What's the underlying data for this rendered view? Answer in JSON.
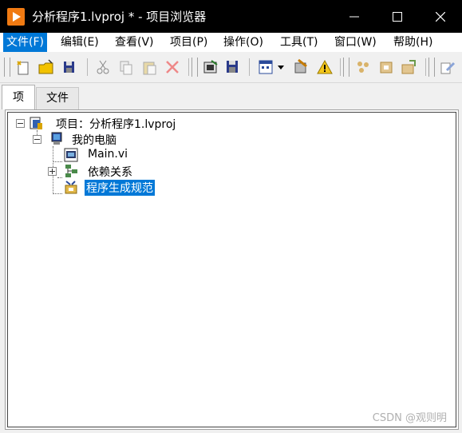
{
  "window": {
    "title": "分析程序1.lvproj * - 项目浏览器",
    "controls": [
      "minimize",
      "maximize",
      "close"
    ]
  },
  "menubar": {
    "items": [
      {
        "label": "文件(F)",
        "active": true
      },
      {
        "label": "编辑(E)"
      },
      {
        "label": "查看(V)"
      },
      {
        "label": "项目(P)"
      },
      {
        "label": "操作(O)"
      },
      {
        "label": "工具(T)"
      },
      {
        "label": "窗口(W)"
      },
      {
        "label": "帮助(H)"
      }
    ]
  },
  "toolbar": {
    "buttons": [
      "new-icon",
      "open-icon",
      "save-all-icon",
      "cut-icon",
      "copy-icon",
      "paste-icon",
      "delete-icon",
      "build-icon",
      "save-icon",
      "view-icon",
      "dropdown-icon",
      "key-icon",
      "warning-icon",
      "group1-icon",
      "group2-icon",
      "group3-icon",
      "edit-icon"
    ]
  },
  "tabs": [
    {
      "label": "项",
      "active": true
    },
    {
      "label": "文件",
      "active": false
    }
  ],
  "tree": {
    "project_label": "项目：分析程序1.lvproj",
    "computer_label": "我的电脑",
    "children": [
      {
        "label": "Main.vi",
        "icon": "vi-icon"
      },
      {
        "label": "依赖关系",
        "icon": "dependencies-icon"
      },
      {
        "label": "程序生成规范",
        "icon": "build-spec-icon",
        "selected": true
      }
    ]
  },
  "watermark": "CSDN @观则明",
  "colors": {
    "accent": "#0078d7",
    "titlebar": "#000000",
    "app_icon": "#f07a12"
  }
}
